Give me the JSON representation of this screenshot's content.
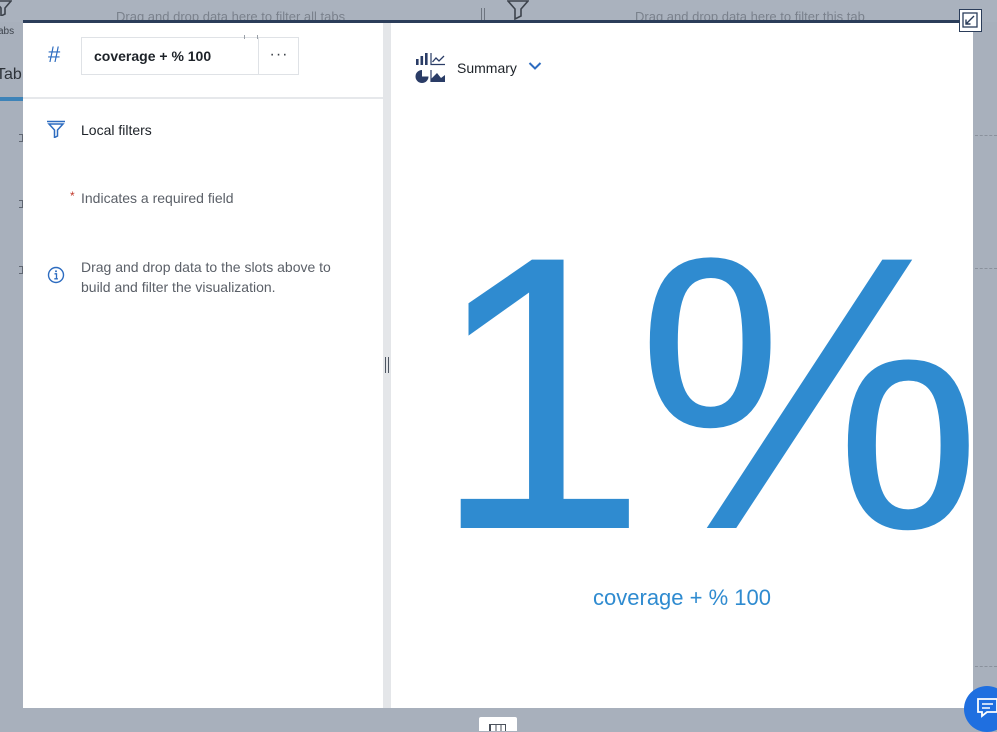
{
  "background": {
    "filter_all_text": "Drag and drop data here to filter all tabs",
    "filter_tab_text": "Drag and drop data here to filter this tab",
    "tabs_small_label": "abs",
    "tab_label": "Tab"
  },
  "left_panel": {
    "field_label": "coverage + % 100",
    "more_label": "···",
    "local_filters_label": "Local filters",
    "required_star": "*",
    "required_text": "Indicates a required field",
    "info_text": "Drag and drop data to the slots above to build and filter the visualization."
  },
  "right_panel": {
    "viz_type_label": "Summary",
    "summary_value": "1%",
    "summary_caption": "coverage + % 100"
  },
  "colors": {
    "accent": "#2f8bd0",
    "icon_blue": "#2d6cc0",
    "topline": "#2b3d5a",
    "chat": "#1f6fe0"
  }
}
